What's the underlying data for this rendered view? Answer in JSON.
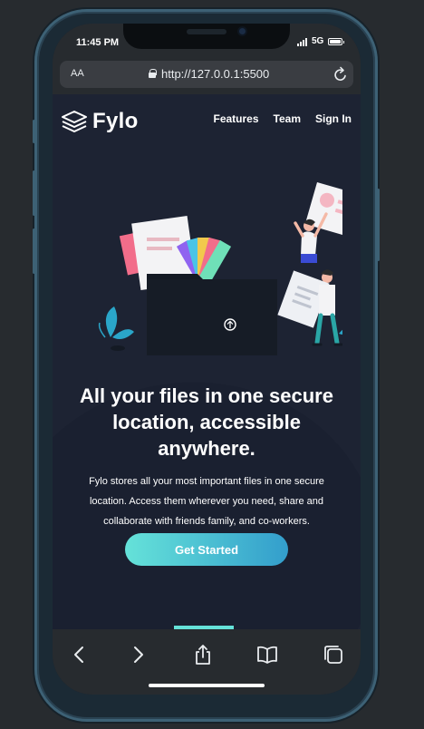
{
  "status_bar": {
    "time": "11:45 PM",
    "network": "5G"
  },
  "browser": {
    "text_size_label": "AA",
    "url": "http://127.0.0.1:5500"
  },
  "site": {
    "logo_text": "Fylo",
    "nav": [
      {
        "label": "Features"
      },
      {
        "label": "Team"
      },
      {
        "label": "Sign In"
      }
    ],
    "hero": {
      "headline": "All your files in one secure location, accessible anywhere.",
      "description": "Fylo stores all your most important files in one secure location. Access them wherever you need, share and collaborate with friends family, and co-workers.",
      "cta_label": "Get Started"
    }
  },
  "colors": {
    "page_bg": "#1d2333",
    "cta_start": "#65e2d9",
    "cta_end": "#339ecc",
    "chrome_bg": "#272b2f",
    "frame": "#3d6175"
  },
  "icons": {
    "toolbar": [
      "back-arrow-icon",
      "forward-arrow-icon",
      "share-icon",
      "bookmarks-icon",
      "tabs-icon"
    ]
  }
}
